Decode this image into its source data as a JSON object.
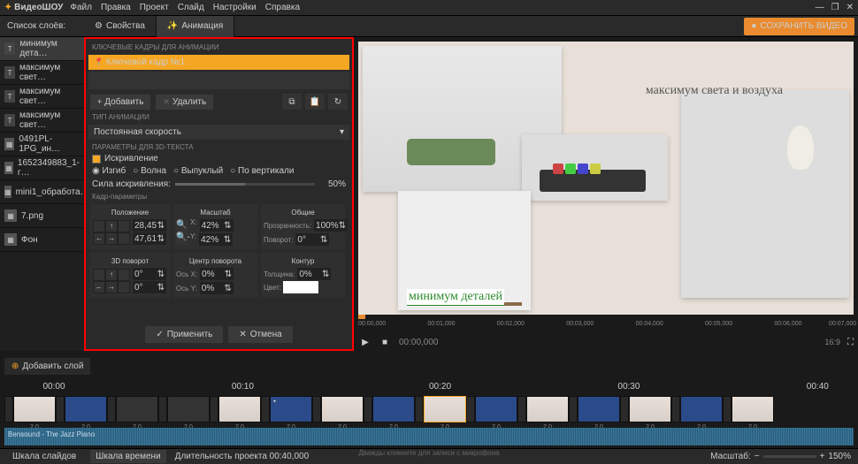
{
  "app": {
    "name": "ВидеоШОУ"
  },
  "menu": [
    "Файл",
    "Правка",
    "Проект",
    "Слайд",
    "Настройки",
    "Справка"
  ],
  "win": {
    "min": "—",
    "max": "❐",
    "close": "✕"
  },
  "headers": {
    "layers": "Список слоёв:"
  },
  "tabs": {
    "props": "Свойства",
    "anim": "Анимация"
  },
  "save": "СОХРАНИТЬ ВИДЕО",
  "layers": [
    {
      "type": "T",
      "name": "минимум дета…",
      "sel": true
    },
    {
      "type": "T",
      "name": "максимум свет…"
    },
    {
      "type": "T",
      "name": "максимум свет…"
    },
    {
      "type": "T",
      "name": "максимум свет…"
    },
    {
      "type": "I",
      "name": "0491PL-1PG_ин…"
    },
    {
      "type": "I",
      "name": "1652349883_1-г…"
    },
    {
      "type": "I",
      "name": "mini1_обработа…"
    },
    {
      "type": "I",
      "name": "7.png"
    },
    {
      "type": "I",
      "name": "Фон"
    }
  ],
  "panel": {
    "sec_keyframes": "КЛЮЧЕВЫЕ КАДРЫ ДЛЯ АНИМАЦИИ",
    "keyframe": "Ключевой кадр №1",
    "add": "Добавить",
    "del": "Удалить",
    "sec_animtype": "ТИП АНИМАЦИИ",
    "animtype": "Постоянная скорость",
    "sec_3dtext": "ПАРАМЕТРЫ ДЛЯ 3D-ТЕКСТА",
    "curvature": "Искривление",
    "radios": [
      "Изгиб",
      "Волна",
      "Выпуклый",
      "По вертикали"
    ],
    "curve_force": "Сила искривления:",
    "curve_val": "50%",
    "sec_frameparams": "Кадр-параметры",
    "groups": {
      "position": "Положение",
      "scale": "Масштаб",
      "general": "Общие",
      "rot3d": "3D поворот",
      "pivot": "Центр поворота",
      "outline": "Контур"
    },
    "vals": {
      "x": "28,45",
      "y": "47,61",
      "sx": "42%",
      "sy": "42%",
      "opacity_l": "Прозрачность:",
      "opacity": "100%",
      "rot_l": "Поворот:",
      "rot": "0°",
      "r3x": "0°",
      "r3y": "0°",
      "px_l": "Ось X:",
      "px": "0%",
      "py_l": "Ось Y:",
      "py": "0%",
      "thick_l": "Толщина:",
      "thick": "0%",
      "color_l": "Цвет:"
    },
    "apply": "Применить",
    "cancel": "Отмена"
  },
  "preview": {
    "text1": "максимум света и воздуха",
    "text2": "минимум деталей"
  },
  "addlayer": "Добавить слой",
  "ruler": [
    "00:00,000",
    "00:01,000",
    "00:02,000",
    "00:03,000",
    "00:04,000",
    "00:05,000",
    "00:06,000",
    "00:07,000"
  ],
  "play": {
    "time": "00:00,000",
    "ratio": "16:9"
  },
  "tlticks": [
    "00:00",
    "00:10",
    "00:20",
    "00:30",
    "00:40"
  ],
  "thumbs": [
    {
      "d": "2.0",
      "c": "col"
    },
    {
      "d": "2.0",
      "c": "blue"
    },
    {
      "d": "2.0",
      "c": ""
    },
    {
      "d": "2.0",
      "c": ""
    },
    {
      "d": "2.0",
      "c": "col"
    },
    {
      "d": "2.0",
      "c": "blue",
      "x": "✦"
    },
    {
      "d": "2.0",
      "c": "col"
    },
    {
      "d": "2.0",
      "c": "blue"
    },
    {
      "d": "2.0",
      "c": "col",
      "sel": true
    },
    {
      "d": "2.0",
      "c": "blue"
    },
    {
      "d": "2.0",
      "c": "col"
    },
    {
      "d": "2.0",
      "c": "blue"
    },
    {
      "d": "2.0",
      "c": "col"
    },
    {
      "d": "2.0",
      "c": "blue"
    },
    {
      "d": "2.0",
      "c": "col"
    }
  ],
  "audio": "Bensound - The Jazz Piano",
  "mic": "Дважды кликните для записи с микрофона",
  "status": {
    "slides": "Шкала слайдов",
    "timeline": "Шкала времени",
    "duration": "Длительность проекта 00:40,000",
    "zoom_l": "Масштаб:",
    "zoom": "150%"
  }
}
